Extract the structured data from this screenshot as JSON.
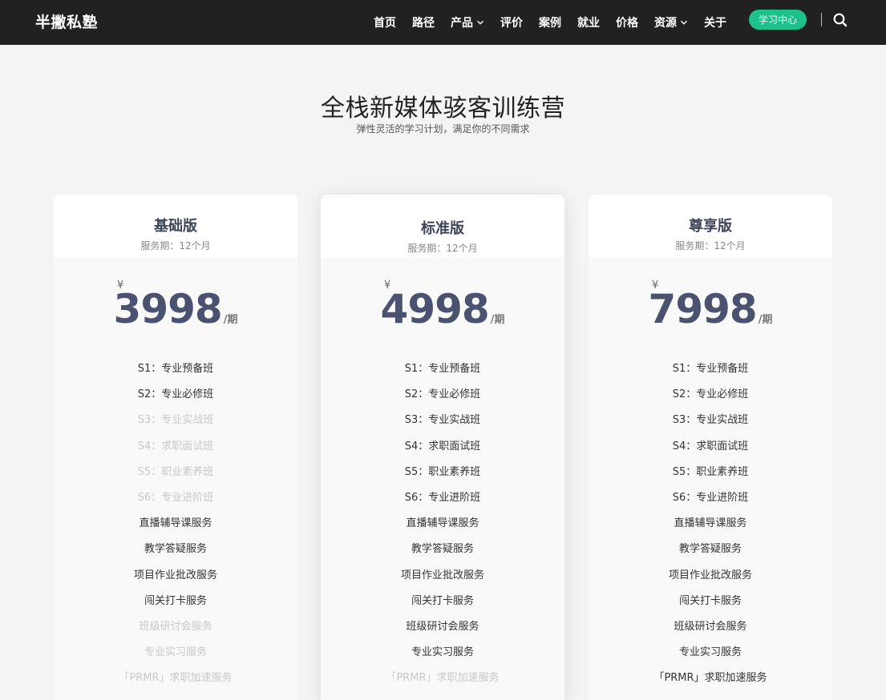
{
  "header": {
    "logo": "半撇私塾",
    "nav": [
      {
        "label": "首页",
        "dropdown": false
      },
      {
        "label": "路径",
        "dropdown": false
      },
      {
        "label": "产品",
        "dropdown": true
      },
      {
        "label": "评价",
        "dropdown": false
      },
      {
        "label": "案例",
        "dropdown": false
      },
      {
        "label": "就业",
        "dropdown": false
      },
      {
        "label": "价格",
        "dropdown": false
      },
      {
        "label": "资源",
        "dropdown": true
      },
      {
        "label": "关于",
        "dropdown": false
      }
    ],
    "learn_button": "学习中心",
    "search_icon": "search-icon"
  },
  "hero": {
    "title": "全栈新媒体骇客训练营",
    "subtitle": "弹性灵活的学习计划，满足你的不同需求"
  },
  "colors": {
    "topbar": "#212121",
    "accent_green": "#1ec08b",
    "price": "#4a5270",
    "disabled_text": "#c8c8c8"
  },
  "plans": [
    {
      "name": "基础版",
      "period": "服务期：12个月",
      "currency": "¥",
      "price": "3998",
      "per": "/期",
      "features": [
        {
          "label": "S1：专业预备班",
          "included": true
        },
        {
          "label": "S2：专业必修班",
          "included": true
        },
        {
          "label": "S3：专业实战班",
          "included": false
        },
        {
          "label": "S4：求职面试班",
          "included": false
        },
        {
          "label": "S5：职业素养班",
          "included": false
        },
        {
          "label": "S6：专业进阶班",
          "included": false
        },
        {
          "label": "直播辅导课服务",
          "included": true
        },
        {
          "label": "教学答疑服务",
          "included": true
        },
        {
          "label": "项目作业批改服务",
          "included": true
        },
        {
          "label": "闯关打卡服务",
          "included": true
        },
        {
          "label": "班级研讨会服务",
          "included": false
        },
        {
          "label": "专业实习服务",
          "included": false
        },
        {
          "label": "「PRMR」求职加速服务",
          "included": false
        }
      ]
    },
    {
      "name": "标准版",
      "period": "服务期：12个月",
      "currency": "¥",
      "price": "4998",
      "per": "/期",
      "features": [
        {
          "label": "S1：专业预备班",
          "included": true
        },
        {
          "label": "S2：专业必修班",
          "included": true
        },
        {
          "label": "S3：专业实战班",
          "included": true
        },
        {
          "label": "S4：求职面试班",
          "included": true
        },
        {
          "label": "S5：职业素养班",
          "included": true
        },
        {
          "label": "S6：专业进阶班",
          "included": true
        },
        {
          "label": "直播辅导课服务",
          "included": true
        },
        {
          "label": "教学答疑服务",
          "included": true
        },
        {
          "label": "项目作业批改服务",
          "included": true
        },
        {
          "label": "闯关打卡服务",
          "included": true
        },
        {
          "label": "班级研讨会服务",
          "included": true
        },
        {
          "label": "专业实习服务",
          "included": true
        },
        {
          "label": "「PRMR」求职加速服务",
          "included": false
        }
      ]
    },
    {
      "name": "尊享版",
      "period": "服务期：12个月",
      "currency": "¥",
      "price": "7998",
      "per": "/期",
      "features": [
        {
          "label": "S1：专业预备班",
          "included": true
        },
        {
          "label": "S2：专业必修班",
          "included": true
        },
        {
          "label": "S3：专业实战班",
          "included": true
        },
        {
          "label": "S4：求职面试班",
          "included": true
        },
        {
          "label": "S5：职业素养班",
          "included": true
        },
        {
          "label": "S6：专业进阶班",
          "included": true
        },
        {
          "label": "直播辅导课服务",
          "included": true
        },
        {
          "label": "教学答疑服务",
          "included": true
        },
        {
          "label": "项目作业批改服务",
          "included": true
        },
        {
          "label": "闯关打卡服务",
          "included": true
        },
        {
          "label": "班级研讨会服务",
          "included": true
        },
        {
          "label": "专业实习服务",
          "included": true
        },
        {
          "label": "「PRMR」求职加速服务",
          "included": true
        }
      ]
    }
  ]
}
